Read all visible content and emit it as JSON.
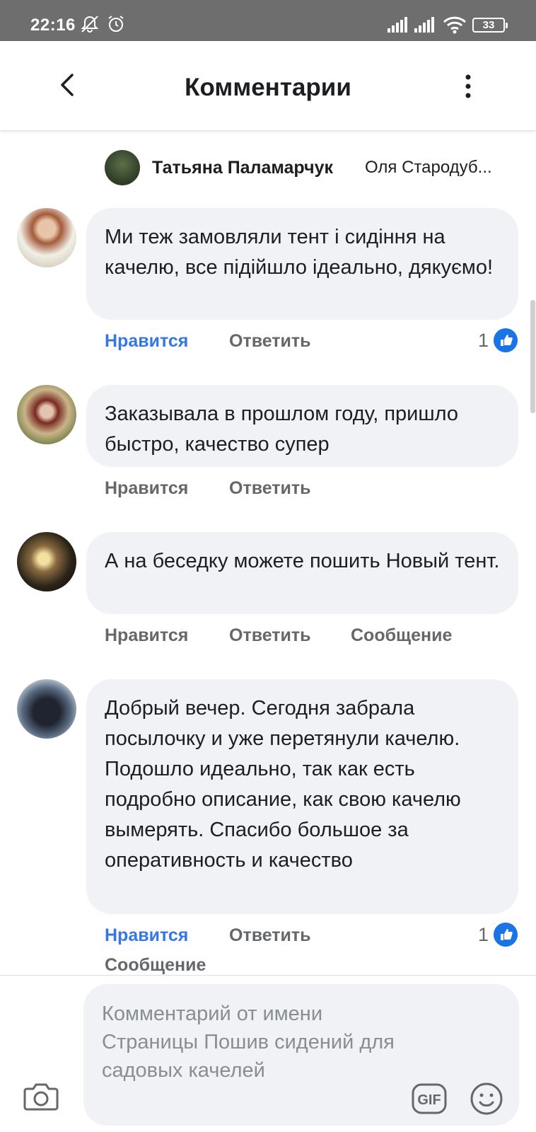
{
  "status_bar": {
    "time": "22:16",
    "battery": "33"
  },
  "header": {
    "title": "Комментарии"
  },
  "reply_context": {
    "author": "Татьяна Паламарчук",
    "reply_to": "Оля Стародуб..."
  },
  "comments": [
    {
      "text": "Ми теж замовляли тент і сидіння на качелю, все підійшло ідеально, дякуємо!",
      "like_label": "Нравится",
      "reply_label": "Ответить",
      "liked": true,
      "reaction_count": "1"
    },
    {
      "text": "Заказывала в прошлом году, пришло быстро, качество супер",
      "like_label": "Нравится",
      "reply_label": "Ответить",
      "liked": false
    },
    {
      "text": "А на беседку можете пошить Новый тент.",
      "like_label": "Нравится",
      "reply_label": "Ответить",
      "message_label": "Сообщение",
      "liked": false
    },
    {
      "text": "Добрый вечер. Сегодня забрала посылочку и уже перетянули качелю. Подошло идеально, так как есть подробно описание, как свою качелю вымерять. Спасибо большое за оперативность и качество",
      "like_label": "Нравится",
      "reply_label": "Ответить",
      "message_label": "Сообщение",
      "liked": true,
      "reaction_count": "1"
    }
  ],
  "composer": {
    "placeholder": "Комментарий от имени Страницы Пошив сидений для садовых качелей",
    "gif_label": "GIF"
  },
  "icons": [
    "notification-off-icon",
    "alarm-icon",
    "signal-icon",
    "wifi-icon",
    "battery-icon",
    "back-icon",
    "more-icon",
    "like-reaction-icon",
    "camera-icon",
    "gif-icon",
    "emoji-icon"
  ],
  "colors": {
    "status_bar": "#6e6e6e",
    "accent_like": "#3578e5",
    "bubble": "#f0f2f5",
    "muted_text": "#65676b"
  }
}
